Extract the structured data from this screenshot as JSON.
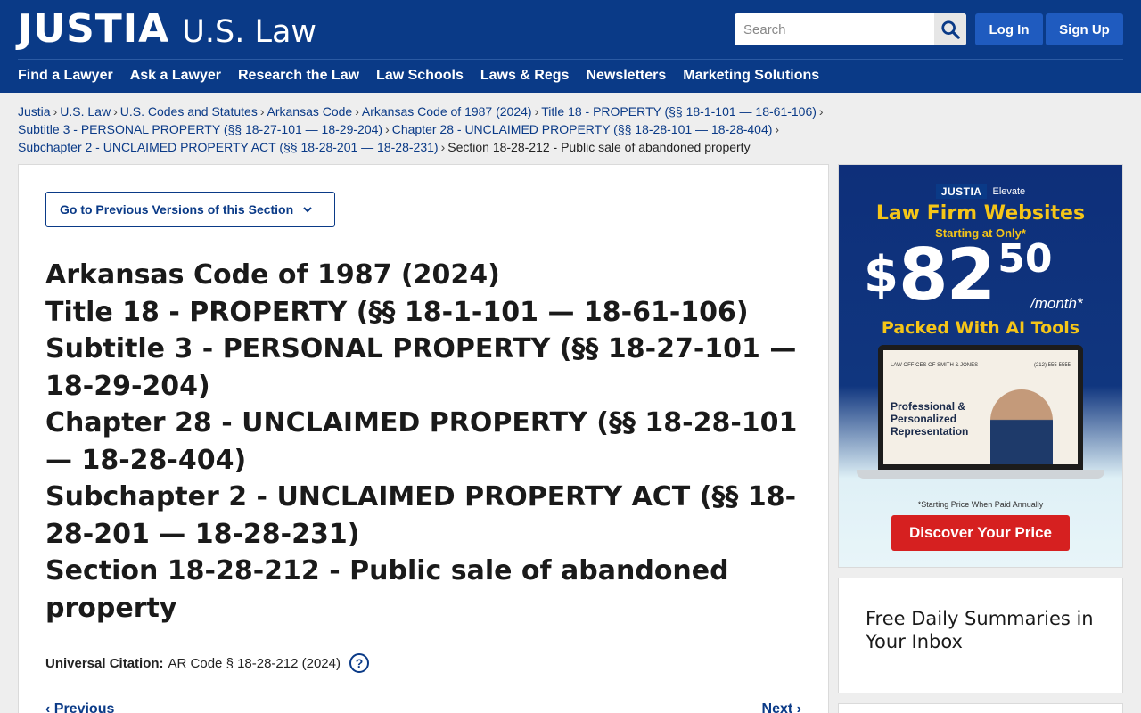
{
  "header": {
    "brand": "JUSTIA",
    "section": "U.S. Law",
    "search_placeholder": "Search",
    "login_label": "Log In",
    "signup_label": "Sign Up",
    "nav": [
      "Find a Lawyer",
      "Ask a Lawyer",
      "Research the Law",
      "Law Schools",
      "Laws & Regs",
      "Newsletters",
      "Marketing Solutions"
    ]
  },
  "breadcrumbs": {
    "links": [
      "Justia",
      "U.S. Law",
      "U.S. Codes and Statutes",
      "Arkansas Code",
      "Arkansas Code of 1987 (2024)",
      "Title 18 - PROPERTY (§§ 18-1-101 — 18-61-106)",
      "Subtitle 3 - PERSONAL PROPERTY (§§ 18-27-101 — 18-29-204)",
      "Chapter 28 - UNCLAIMED PROPERTY (§§ 18-28-101 — 18-28-404)",
      "Subchapter 2 - UNCLAIMED PROPERTY ACT (§§ 18-28-201 — 18-28-231)"
    ],
    "current": "Section 18-28-212 - Public sale of abandoned property",
    "separator": "›"
  },
  "main": {
    "prev_versions_label": "Go to Previous Versions of this Section",
    "heading_lines": [
      "Arkansas Code of 1987 (2024)",
      "Title 18 - PROPERTY (§§ 18-1-101 — 18-61-106)",
      "Subtitle 3 - PERSONAL PROPERTY (§§ 18-27-101 — 18-29-204)",
      "Chapter 28 - UNCLAIMED PROPERTY (§§ 18-28-101 — 18-28-404)",
      "Subchapter 2 - UNCLAIMED PROPERTY ACT (§§ 18-28-201 — 18-28-231)",
      "Section 18-28-212 - Public sale of abandoned property"
    ],
    "citation_label": "Universal Citation:",
    "citation_value": "AR Code § 18-28-212 (2024)",
    "help_glyph": "?",
    "prev_label": "Previous",
    "next_label": "Next"
  },
  "ad": {
    "brand": "JUSTIA",
    "brand_sub": "Elevate",
    "title": "Law Firm Websites",
    "starting": "Starting at Only*",
    "currency": "$",
    "price_whole": "82",
    "price_cents": "50",
    "per": "/month*",
    "packed": "Packed With AI Tools",
    "firm_name": "LAW OFFICES OF SMITH & JONES",
    "firm_phone": "(212) 555-5555",
    "tagline": "Professional & Personalized Representation",
    "fine_print": "*Starting Price When Paid Annually",
    "cta": "Discover Your Price"
  },
  "newsletter": {
    "title": "Free Daily Summaries in Your Inbox"
  },
  "colors": {
    "header_bg": "#0a3a87",
    "auth_button": "#1f5bbf",
    "link": "#0a3a87",
    "cta_red": "#d62020",
    "ad_yellow": "#f5c518"
  }
}
